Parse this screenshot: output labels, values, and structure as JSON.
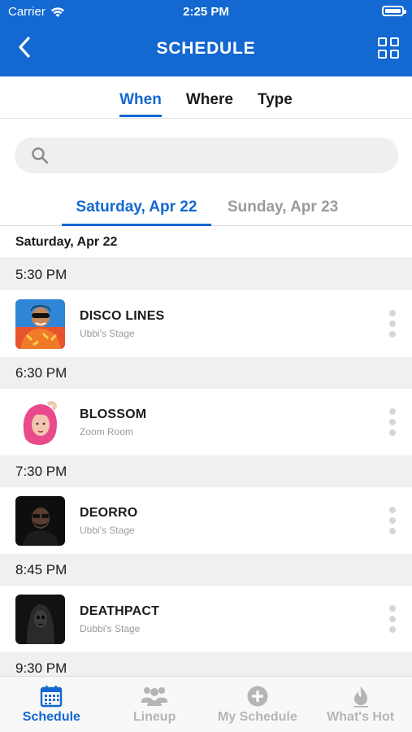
{
  "status_bar": {
    "carrier": "Carrier",
    "time": "2:25 PM"
  },
  "nav": {
    "title": "SCHEDULE"
  },
  "filter_tabs": [
    {
      "label": "When",
      "active": true
    },
    {
      "label": "Where",
      "active": false
    },
    {
      "label": "Type",
      "active": false
    }
  ],
  "search": {
    "placeholder": ""
  },
  "day_tabs": [
    {
      "label": "Saturday, Apr 22",
      "active": true
    },
    {
      "label": "Sunday, Apr 23",
      "active": false
    }
  ],
  "list": {
    "date_header": "Saturday, Apr 22",
    "slots": [
      {
        "time": "5:30 PM",
        "artist": "DISCO LINES",
        "stage": "Ubbi's Stage"
      },
      {
        "time": "6:30 PM",
        "artist": "BLOSSOM",
        "stage": "Zoom Room"
      },
      {
        "time": "7:30 PM",
        "artist": "DEORRO",
        "stage": "Ubbi's Stage"
      },
      {
        "time": "8:45 PM",
        "artist": "DEATHPACT",
        "stage": "Dubbi's Stage"
      },
      {
        "time": "9:30 PM"
      }
    ]
  },
  "tabbar": [
    {
      "label": "Schedule",
      "icon": "calendar-icon",
      "active": true
    },
    {
      "label": "Lineup",
      "icon": "people-icon",
      "active": false
    },
    {
      "label": "My Schedule",
      "icon": "plus-circle-icon",
      "active": false
    },
    {
      "label": "What's Hot",
      "icon": "flame-icon",
      "active": false
    }
  ],
  "colors": {
    "accent": "#1368d1",
    "inactive": "#b5b5b5",
    "section_bg": "#f0f0f0"
  }
}
